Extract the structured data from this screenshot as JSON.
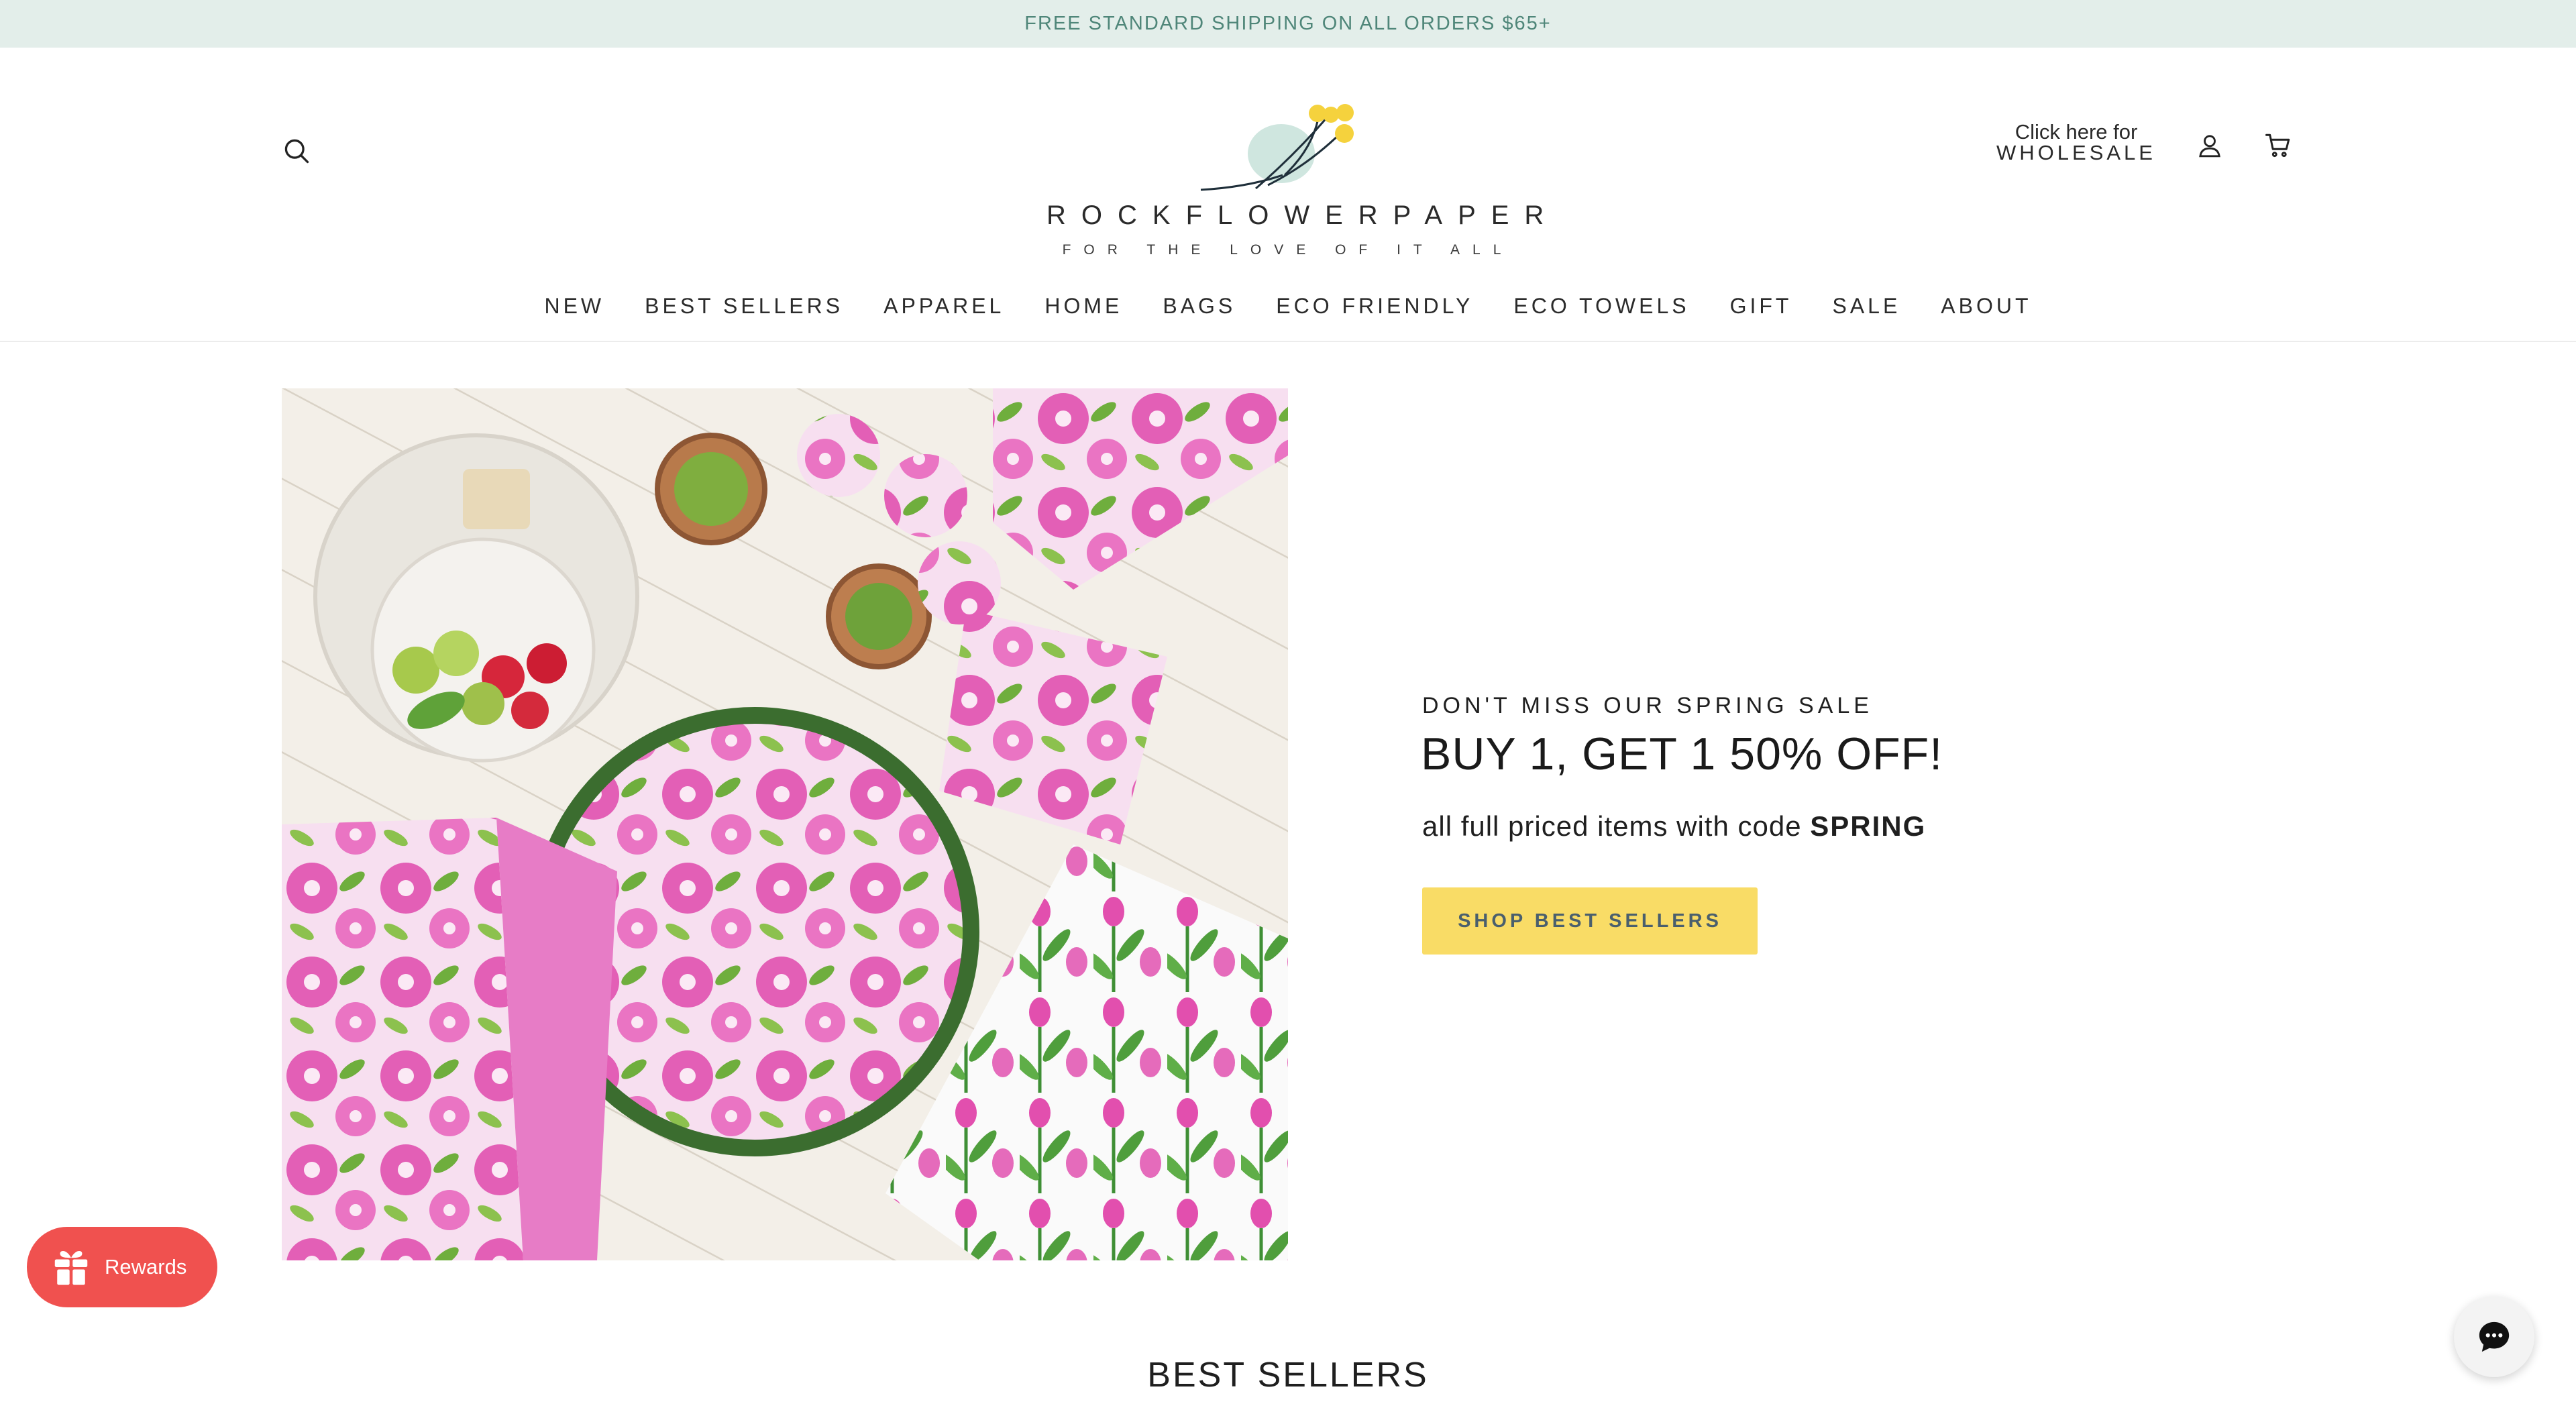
{
  "announcement": {
    "text": "FREE STANDARD SHIPPING ON ALL ORDERS $65+"
  },
  "brand": {
    "name": "ROCKFLOWERPAPER",
    "tagline": "FOR THE LOVE OF IT ALL"
  },
  "header": {
    "wholesale_line1": "Click here for",
    "wholesale_line2": "WHOLESALE",
    "icons": [
      "search-icon",
      "account-icon",
      "cart-icon"
    ]
  },
  "nav": {
    "items": [
      {
        "label": "NEW"
      },
      {
        "label": "BEST SELLERS"
      },
      {
        "label": "APPAREL"
      },
      {
        "label": "HOME"
      },
      {
        "label": "BAGS"
      },
      {
        "label": "ECO FRIENDLY"
      },
      {
        "label": "ECO TOWELS"
      },
      {
        "label": "GIFT"
      },
      {
        "label": "SALE"
      },
      {
        "label": "ABOUT"
      }
    ]
  },
  "hero": {
    "eyebrow": "DON'T MISS OUR SPRING SALE",
    "headline": "BUY 1, GET 1 50% OFF!",
    "subline_prefix": "all full priced items with code ",
    "code": "SPRING",
    "cta_label": "SHOP BEST SELLERS"
  },
  "rewards": {
    "label": "Rewards"
  },
  "sections": {
    "best_sellers_title": "BEST SELLERS"
  },
  "colors": {
    "announcement_bg": "#e3eeea",
    "announcement_text": "#4f8679",
    "cta_bg": "#f9dc66",
    "rewards_bg": "#f0514f",
    "brand_yellow": "#f5d23d",
    "brand_mint": "#cfe6df"
  }
}
